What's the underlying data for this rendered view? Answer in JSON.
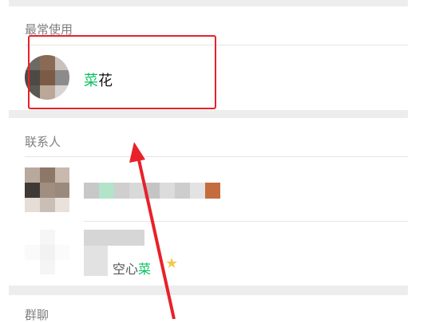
{
  "sections": {
    "frequent": "最常使用",
    "contacts": "联系人",
    "groups": "群聊"
  },
  "frequent_result": {
    "name_highlight": "菜",
    "name_rest": "花"
  },
  "contact_result": {
    "name_prefix_visible": "空心",
    "name_highlight": "菜",
    "star_icon": "star-icon"
  },
  "colors": {
    "highlight_green": "#07c160",
    "annotation_red": "#e8212a",
    "section_gap": "#ededed"
  }
}
